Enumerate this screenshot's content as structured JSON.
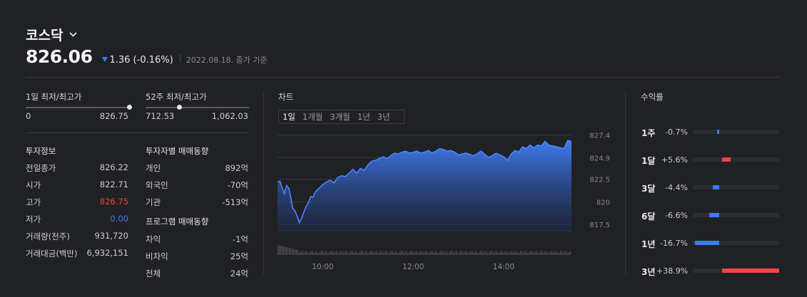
{
  "index": {
    "name": "코스닥",
    "price": "826.06",
    "change": "1.36 (-0.16%)",
    "date": "2022.08.18. 종가 기준"
  },
  "daily_range": {
    "label": "1일 최저/최고가",
    "low": "0",
    "high": "826.75",
    "position": 1.0
  },
  "week52_range": {
    "label": "52주 최저/최고가",
    "low": "712.53",
    "high": "1,062.03",
    "position": 0.33
  },
  "invest_info": {
    "title": "투자정보",
    "rows": [
      {
        "label": "전일종가",
        "value": "826.22"
      },
      {
        "label": "시가",
        "value": "822.71"
      },
      {
        "label": "고가",
        "value": "826.75"
      },
      {
        "label": "저가",
        "value": "0.00"
      },
      {
        "label": "거래량(천주)",
        "value": "931,720"
      },
      {
        "label": "거래대금(백만)",
        "value": "6,932,151"
      }
    ]
  },
  "investor_trend": {
    "title": "투자자별 매매동향",
    "rows": [
      {
        "label": "개인",
        "value": "892억"
      },
      {
        "label": "외국인",
        "value": "-70억"
      },
      {
        "label": "기관",
        "value": "-513억"
      }
    ]
  },
  "program_trend": {
    "title": "프로그램 매매동향",
    "rows": [
      {
        "label": "차익",
        "value": "-1억"
      },
      {
        "label": "비차익",
        "value": "25억"
      },
      {
        "label": "전체",
        "value": "24억"
      }
    ]
  },
  "chart": {
    "title": "차트",
    "tabs": [
      "1일",
      "1개월",
      "3개월",
      "1년",
      "3년"
    ],
    "active_tab": 0
  },
  "returns": {
    "title": "수익률",
    "rows": [
      {
        "label": "1주",
        "value": "-0.7%",
        "pct": -0.7
      },
      {
        "label": "1달",
        "value": "+5.6%",
        "pct": 5.6
      },
      {
        "label": "3달",
        "value": "-4.4%",
        "pct": -4.4
      },
      {
        "label": "6달",
        "value": "-6.6%",
        "pct": -6.6
      },
      {
        "label": "1년",
        "value": "-16.7%",
        "pct": -16.7
      },
      {
        "label": "3년",
        "value": "+38.9%",
        "pct": 38.9
      }
    ]
  },
  "colors": {
    "up": "#f04646",
    "down": "#3b7cf5",
    "line": "#4b86ff"
  },
  "chart_data": {
    "type": "area",
    "y_ticks": [
      "827.4",
      "824.9",
      "822.5",
      "820",
      "817.5"
    ],
    "y_tick_values": [
      827.4,
      824.9,
      822.5,
      820,
      817.5
    ],
    "ylim": [
      816.8,
      828.0
    ],
    "x_ticks": [
      "10:00",
      "12:00",
      "14:00"
    ],
    "x_tick_values": [
      60,
      180,
      300
    ],
    "xlim": [
      0,
      390
    ],
    "x": [
      0,
      3,
      6,
      9,
      12,
      15,
      18,
      20,
      23,
      26,
      29,
      32,
      35,
      38,
      41,
      44,
      47,
      50,
      55,
      60,
      65,
      70,
      75,
      80,
      85,
      90,
      95,
      100,
      105,
      110,
      115,
      120,
      125,
      130,
      135,
      140,
      145,
      150,
      155,
      160,
      165,
      170,
      175,
      180,
      185,
      190,
      195,
      200,
      205,
      210,
      215,
      220,
      225,
      230,
      235,
      240,
      250,
      260,
      270,
      280,
      290,
      300,
      305,
      310,
      315,
      320,
      325,
      330,
      335,
      340,
      345,
      350,
      355,
      360,
      365,
      370,
      375,
      380,
      385,
      390
    ],
    "values": [
      822.2,
      822.3,
      821.6,
      820.9,
      821.8,
      821.5,
      820.3,
      819.3,
      819.0,
      818.4,
      817.7,
      818.2,
      818.9,
      819.5,
      819.9,
      820.6,
      820.5,
      821.1,
      821.5,
      821.9,
      822.2,
      822.4,
      822.1,
      822.7,
      822.9,
      822.8,
      823.2,
      823.6,
      823.2,
      823.7,
      823.5,
      824.1,
      824.5,
      824.6,
      824.8,
      825.0,
      824.8,
      825.1,
      825.4,
      825.3,
      825.5,
      825.6,
      825.4,
      825.5,
      825.6,
      825.4,
      825.5,
      825.7,
      825.4,
      825.6,
      825.9,
      825.8,
      825.6,
      825.7,
      825.5,
      825.2,
      825.4,
      825.1,
      825.6,
      824.9,
      825.4,
      825.0,
      824.6,
      825.3,
      825.7,
      825.5,
      826.1,
      825.9,
      826.3,
      826.0,
      826.3,
      826.2,
      826.7,
      826.3,
      826.2,
      826.1,
      826.0,
      825.9,
      826.8,
      826.7
    ]
  }
}
